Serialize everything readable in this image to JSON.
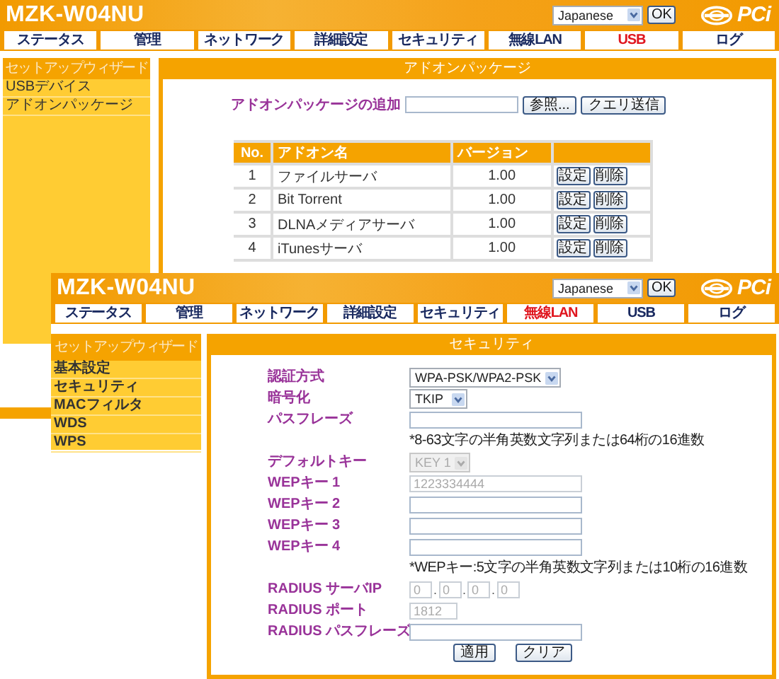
{
  "screens": [
    {
      "product": "MZK-W04NU",
      "language": "Japanese",
      "ok": "OK",
      "logo": "PCi",
      "tabs": [
        {
          "label": "ステータス",
          "selected": false
        },
        {
          "label": "管理",
          "selected": false
        },
        {
          "label": "ネットワーク",
          "selected": false
        },
        {
          "label": "詳細設定",
          "selected": false
        },
        {
          "label": "セキュリティ",
          "selected": false
        },
        {
          "label": "無線LAN",
          "selected": false
        },
        {
          "label": "USB",
          "selected": true
        },
        {
          "label": "ログ",
          "selected": false
        }
      ],
      "sidebar": {
        "header": "セットアップウィザード",
        "items": [
          "USBデバイス",
          "アドオンパッケージ"
        ]
      },
      "panel": {
        "kind": "addon",
        "title": "アドオンパッケージ",
        "add_label": "アドオンパッケージの追加",
        "browse": "参照...",
        "submit": "クエリ送信",
        "columns": [
          "No.",
          "アドオン名",
          "バージョン"
        ],
        "rows": [
          {
            "no": "1",
            "name": "ファイルサーバ",
            "version": "1.00",
            "actions": [
              "設定",
              "削除"
            ]
          },
          {
            "no": "2",
            "name": "Bit Torrent",
            "version": "1.00",
            "actions": [
              "設定",
              "削除"
            ]
          },
          {
            "no": "3",
            "name": "DLNAメディアサーバ",
            "version": "1.00",
            "actions": [
              "設定",
              "削除"
            ]
          },
          {
            "no": "4",
            "name": "iTunesサーバ",
            "version": "1.00",
            "actions": [
              "設定",
              "削除"
            ]
          }
        ]
      }
    },
    {
      "product": "MZK-W04NU",
      "language": "Japanese",
      "ok": "OK",
      "logo": "PCi",
      "tabs": [
        {
          "label": "ステータス",
          "selected": false
        },
        {
          "label": "管理",
          "selected": false
        },
        {
          "label": "ネットワーク",
          "selected": false
        },
        {
          "label": "詳細設定",
          "selected": false
        },
        {
          "label": "セキュリティ",
          "selected": false
        },
        {
          "label": "無線LAN",
          "selected": true
        },
        {
          "label": "USB",
          "selected": false
        },
        {
          "label": "ログ",
          "selected": false
        }
      ],
      "sidebar": {
        "header": "セットアップウィザード",
        "items": [
          "基本設定",
          "セキュリティ",
          "MACフィルタ",
          "WDS",
          "WPS"
        ]
      },
      "panel": {
        "kind": "form",
        "title": "セキュリティ",
        "rows": [
          {
            "kind": "select",
            "label": "認証方式",
            "value": "WPA-PSK/WPA2-PSK",
            "disabled": false
          },
          {
            "kind": "select",
            "label": "暗号化",
            "value": "TKIP",
            "disabled": false
          },
          {
            "kind": "text",
            "label": "パスフレーズ",
            "disabled": false
          },
          {
            "kind": "note",
            "text": "*8-63文字の半角英数文字列または64桁の16進数"
          },
          {
            "kind": "select",
            "label": "デフォルトキー",
            "value": "KEY 1",
            "disabled": true
          },
          {
            "kind": "text",
            "label": "WEPキー 1",
            "value": "1223334444",
            "disabled": true
          },
          {
            "kind": "text",
            "label": "WEPキー 2",
            "disabled": false
          },
          {
            "kind": "text",
            "label": "WEPキー 3",
            "disabled": false
          },
          {
            "kind": "text",
            "label": "WEPキー 4",
            "disabled": false
          },
          {
            "kind": "note",
            "text": "*WEPキー:5文字の半角英数文字列または10桁の16進数"
          },
          {
            "kind": "ip",
            "label": "RADIUS サーバIP",
            "values": [
              "0",
              "0",
              "0",
              "0"
            ],
            "separator": ".",
            "disabled": true
          },
          {
            "kind": "short",
            "label": "RADIUS ポート",
            "value": "1812",
            "disabled": true
          },
          {
            "kind": "text",
            "label": "RADIUS パスフレーズ",
            "disabled": false
          }
        ],
        "buttons": [
          "適用",
          "クリア"
        ]
      }
    }
  ]
}
